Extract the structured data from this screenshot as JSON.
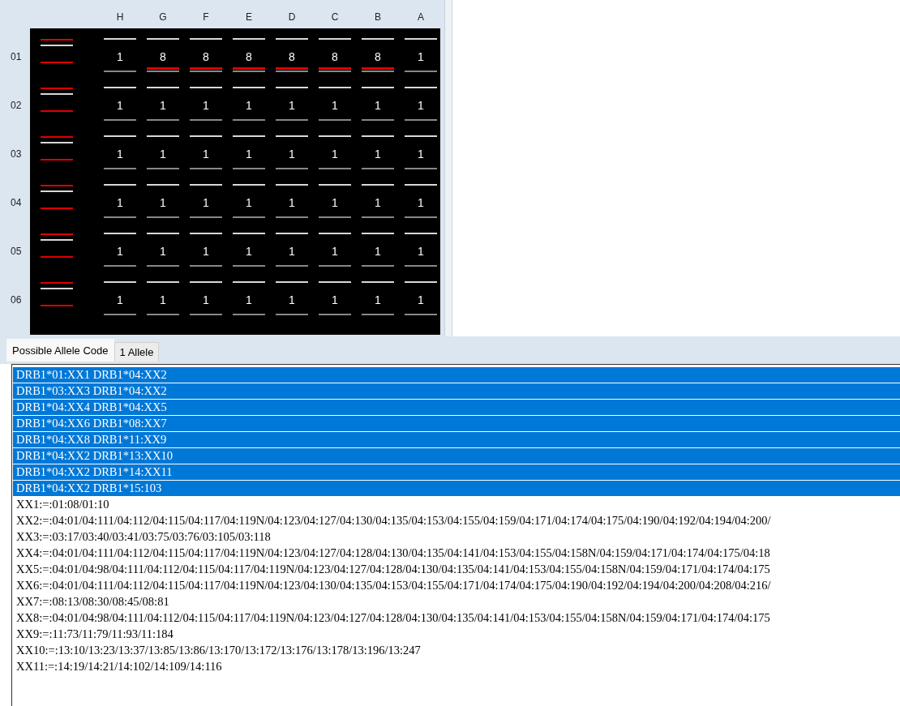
{
  "plate": {
    "columns": [
      "H",
      "G",
      "F",
      "E",
      "D",
      "C",
      "B",
      "A"
    ],
    "rows": [
      {
        "label": "01",
        "cells": [
          {
            "value": "1",
            "marked": false
          },
          {
            "value": "8",
            "marked": true
          },
          {
            "value": "8",
            "marked": true
          },
          {
            "value": "8",
            "marked": true
          },
          {
            "value": "8",
            "marked": true
          },
          {
            "value": "8",
            "marked": true
          },
          {
            "value": "8",
            "marked": true
          },
          {
            "value": "1",
            "marked": false
          }
        ]
      },
      {
        "label": "02",
        "cells": [
          {
            "value": "1",
            "marked": false
          },
          {
            "value": "1",
            "marked": false
          },
          {
            "value": "1",
            "marked": false
          },
          {
            "value": "1",
            "marked": false
          },
          {
            "value": "1",
            "marked": false
          },
          {
            "value": "1",
            "marked": false
          },
          {
            "value": "1",
            "marked": false
          },
          {
            "value": "1",
            "marked": false
          }
        ]
      },
      {
        "label": "03",
        "cells": [
          {
            "value": "1",
            "marked": false
          },
          {
            "value": "1",
            "marked": false
          },
          {
            "value": "1",
            "marked": false
          },
          {
            "value": "1",
            "marked": false
          },
          {
            "value": "1",
            "marked": false
          },
          {
            "value": "1",
            "marked": false
          },
          {
            "value": "1",
            "marked": false
          },
          {
            "value": "1",
            "marked": false
          }
        ]
      },
      {
        "label": "04",
        "cells": [
          {
            "value": "1",
            "marked": false
          },
          {
            "value": "1",
            "marked": false
          },
          {
            "value": "1",
            "marked": false
          },
          {
            "value": "1",
            "marked": false
          },
          {
            "value": "1",
            "marked": false
          },
          {
            "value": "1",
            "marked": false
          },
          {
            "value": "1",
            "marked": false
          },
          {
            "value": "1",
            "marked": false
          }
        ]
      },
      {
        "label": "05",
        "cells": [
          {
            "value": "1",
            "marked": false
          },
          {
            "value": "1",
            "marked": false
          },
          {
            "value": "1",
            "marked": false
          },
          {
            "value": "1",
            "marked": false
          },
          {
            "value": "1",
            "marked": false
          },
          {
            "value": "1",
            "marked": false
          },
          {
            "value": "1",
            "marked": false
          },
          {
            "value": "1",
            "marked": false
          }
        ]
      },
      {
        "label": "06",
        "cells": [
          {
            "value": "1",
            "marked": false
          },
          {
            "value": "1",
            "marked": false
          },
          {
            "value": "1",
            "marked": false
          },
          {
            "value": "1",
            "marked": false
          },
          {
            "value": "1",
            "marked": false
          },
          {
            "value": "1",
            "marked": false
          },
          {
            "value": "1",
            "marked": false
          },
          {
            "value": "1",
            "marked": false
          }
        ]
      }
    ]
  },
  "tabs": [
    {
      "label": "Possible Allele Code",
      "selected": true
    },
    {
      "label": "1 Allele",
      "selected": false
    }
  ],
  "list": [
    {
      "text": "DRB1*01:XX1 DRB1*04:XX2",
      "selected": true
    },
    {
      "text": "DRB1*03:XX3 DRB1*04:XX2",
      "selected": true
    },
    {
      "text": "DRB1*04:XX4 DRB1*04:XX5",
      "selected": true
    },
    {
      "text": "DRB1*04:XX6 DRB1*08:XX7",
      "selected": true
    },
    {
      "text": "DRB1*04:XX8 DRB1*11:XX9",
      "selected": true
    },
    {
      "text": "DRB1*04:XX2 DRB1*13:XX10",
      "selected": true
    },
    {
      "text": "DRB1*04:XX2 DRB1*14:XX11",
      "selected": true
    },
    {
      "text": "DRB1*04:XX2 DRB1*15:103",
      "selected": true
    },
    {
      "text": "XX1:=:01:08/01:10",
      "selected": false
    },
    {
      "text": "XX2:=:04:01/04:111/04:112/04:115/04:117/04:119N/04:123/04:127/04:130/04:135/04:153/04:155/04:159/04:171/04:174/04:175/04:190/04:192/04:194/04:200/",
      "selected": false
    },
    {
      "text": "XX3:=:03:17/03:40/03:41/03:75/03:76/03:105/03:118",
      "selected": false
    },
    {
      "text": "XX4:=:04:01/04:111/04:112/04:115/04:117/04:119N/04:123/04:127/04:128/04:130/04:135/04:141/04:153/04:155/04:158N/04:159/04:171/04:174/04:175/04:18",
      "selected": false
    },
    {
      "text": "XX5:=:04:01/04:98/04:111/04:112/04:115/04:117/04:119N/04:123/04:127/04:128/04:130/04:135/04:141/04:153/04:155/04:158N/04:159/04:171/04:174/04:175",
      "selected": false
    },
    {
      "text": "XX6:=:04:01/04:111/04:112/04:115/04:117/04:119N/04:123/04:130/04:135/04:153/04:155/04:171/04:174/04:175/04:190/04:192/04:194/04:200/04:208/04:216/",
      "selected": false
    },
    {
      "text": "XX7:=:08:13/08:30/08:45/08:81",
      "selected": false
    },
    {
      "text": "XX8:=:04:01/04:98/04:111/04:112/04:115/04:117/04:119N/04:123/04:127/04:128/04:130/04:135/04:141/04:153/04:155/04:158N/04:159/04:171/04:174/04:175",
      "selected": false
    },
    {
      "text": "XX9:=:11:73/11:79/11:93/11:184",
      "selected": false
    },
    {
      "text": "XX10:=:13:10/13:23/13:37/13:85/13:86/13:170/13:172/13:176/13:178/13:196/13:247",
      "selected": false
    },
    {
      "text": "XX11:=:14:19/14:21/14:102/14:109/14:116",
      "selected": false
    }
  ]
}
